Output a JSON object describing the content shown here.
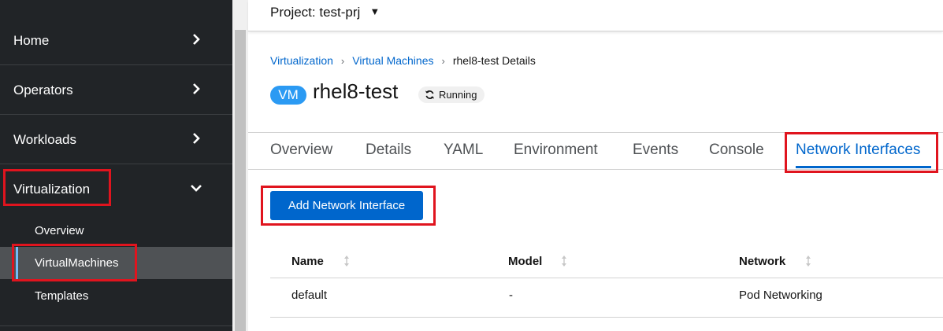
{
  "sidebar": {
    "nav": [
      {
        "label": "Home"
      },
      {
        "label": "Operators"
      },
      {
        "label": "Workloads"
      },
      {
        "label": "Virtualization"
      }
    ],
    "virtualization_items": [
      {
        "label": "Overview"
      },
      {
        "label": "VirtualMachines"
      },
      {
        "label": "Templates"
      }
    ]
  },
  "topbar": {
    "project_label": "Project: test-prj"
  },
  "breadcrumb": [
    {
      "label": "Virtualization"
    },
    {
      "label": "Virtual Machines"
    },
    {
      "label": "rhel8-test Details"
    }
  ],
  "vm": {
    "badge": "VM",
    "name": "rhel8-test",
    "status": "Running"
  },
  "tabs": [
    {
      "label": "Overview"
    },
    {
      "label": "Details"
    },
    {
      "label": "YAML"
    },
    {
      "label": "Environment"
    },
    {
      "label": "Events"
    },
    {
      "label": "Console"
    },
    {
      "label": "Network Interfaces",
      "active": true
    }
  ],
  "add_button_label": "Add Network Interface",
  "table": {
    "columns": [
      "Name",
      "Model",
      "Network"
    ],
    "rows": [
      [
        "default",
        "-",
        "Pod Networking"
      ]
    ]
  },
  "colors": {
    "highlight": "#e0141e",
    "primary": "#0066cc",
    "sidebar_bg": "#212427",
    "vm_badge": "#2b9af3"
  }
}
